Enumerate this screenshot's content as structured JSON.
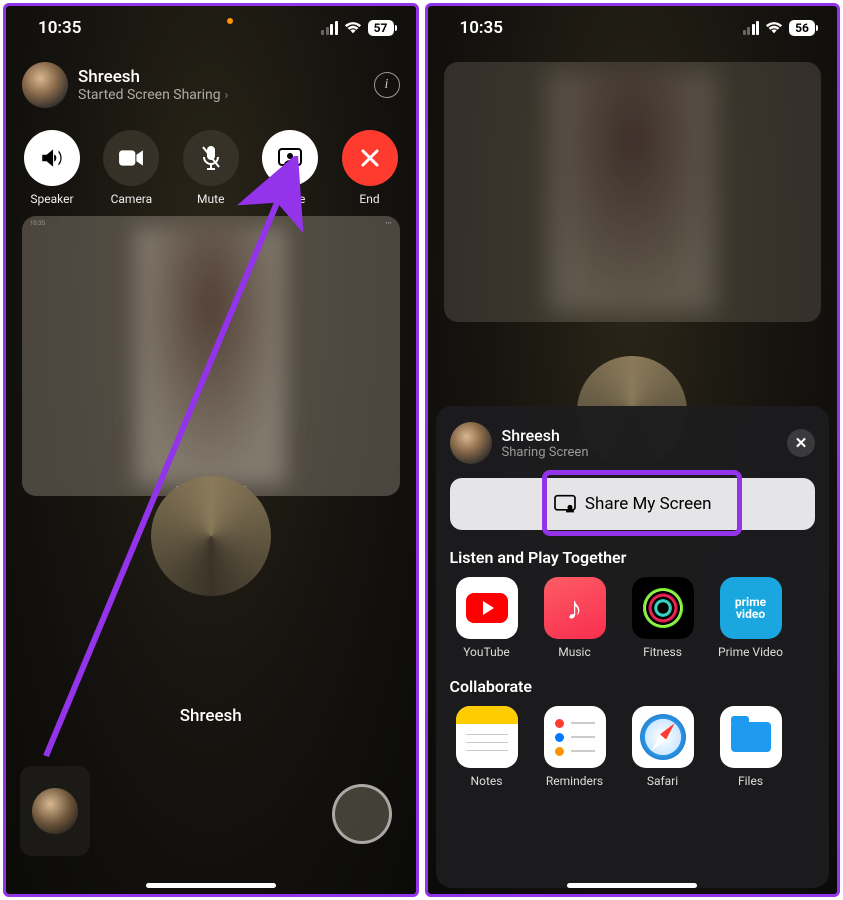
{
  "left": {
    "status": {
      "time": "10:35",
      "battery": "57"
    },
    "caller": {
      "name": "Shreesh",
      "subtitle": "Started Screen Sharing"
    },
    "controls": {
      "speaker": "Speaker",
      "camera": "Camera",
      "mute": "Mute",
      "share": "Share",
      "end": "End"
    },
    "participant_name": "Shreesh"
  },
  "right": {
    "status": {
      "time": "10:35",
      "battery": "56"
    },
    "sheet": {
      "name": "Shreesh",
      "subtitle": "Sharing Screen",
      "share_button": "Share My Screen",
      "listen_title": "Listen and Play Together",
      "collab_title": "Collaborate",
      "listen_apps": {
        "youtube": "YouTube",
        "music": "Music",
        "fitness": "Fitness",
        "prime": "Prime Video"
      },
      "collab_apps": {
        "notes": "Notes",
        "reminders": "Reminders",
        "safari": "Safari",
        "files": "Files"
      },
      "prime_text_top": "prime",
      "prime_text_bottom": "video"
    }
  }
}
